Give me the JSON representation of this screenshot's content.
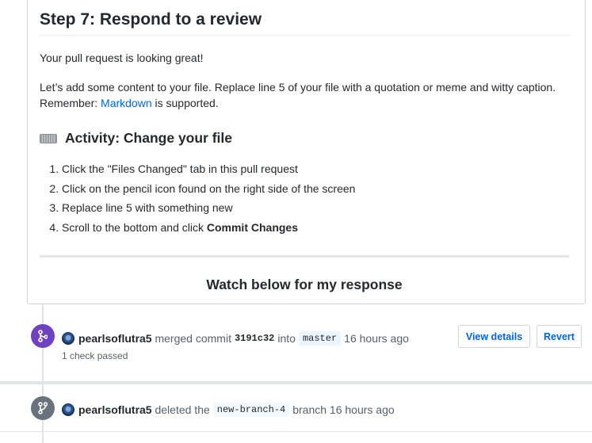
{
  "step": {
    "title": "Step 7: Respond to a review",
    "intro": "Your pull request is looking great!",
    "body_prefix": "Let’s add some content to your file. Replace line 5 of your file with a quotation or meme and witty caption. Remember: ",
    "body_link": "Markdown",
    "body_suffix": " is supported."
  },
  "activity": {
    "icon": "keyboard-icon",
    "title": "Activity: Change your file",
    "steps": [
      "Click the \"Files Changed\" tab in this pull request",
      "Click on the pencil icon found on the right side of the screen",
      "Replace line 5 with something new",
      "Scroll to the bottom and click "
    ],
    "step4_bold": "Commit Changes"
  },
  "watch_text": "Watch below for my response",
  "events": {
    "merged": {
      "user": "pearlsoflutra5",
      "action": "merged commit",
      "sha": "3191c32",
      "into": "into",
      "branch": "master",
      "time": "16 hours ago",
      "checks": "1 check passed",
      "view_details": "View details",
      "revert": "Revert"
    },
    "deleted": {
      "user": "pearlsoflutra5",
      "action": "deleted the",
      "branch": "new-branch-4",
      "suffix": "branch",
      "time": "16 hours ago"
    }
  },
  "colors": {
    "merged_badge": "#6f42c1",
    "deleted_badge": "#6a737d",
    "link": "#0366d6"
  }
}
